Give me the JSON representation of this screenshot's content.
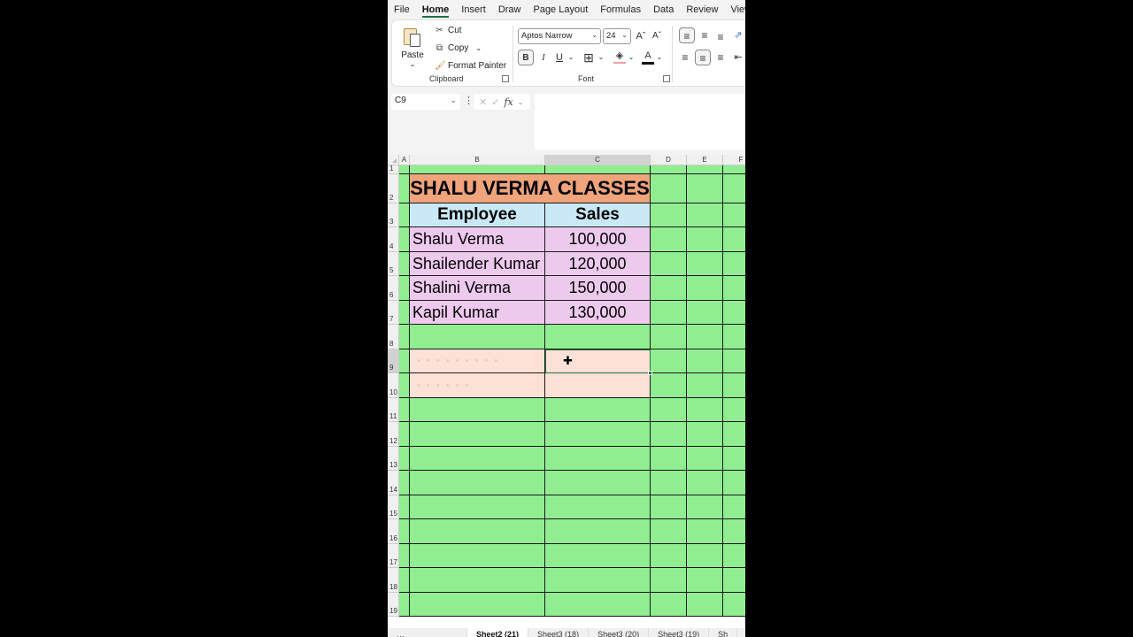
{
  "menu": {
    "tabs": [
      "File",
      "Home",
      "Insert",
      "Draw",
      "Page Layout",
      "Formulas",
      "Data",
      "Review",
      "View"
    ],
    "active": "Home"
  },
  "ribbon": {
    "clipboard": {
      "paste_label": "Paste",
      "cut_label": "Cut",
      "copy_label": "Copy",
      "format_painter_label": "Format Painter",
      "group_label": "Clipboard"
    },
    "font": {
      "font_name": "Aptos Narrow",
      "font_size": "24",
      "grow_label": "Aˆ",
      "shrink_label": "Aˇ",
      "bold_label": "B",
      "italic_label": "I",
      "underline_label": "U",
      "font_color_label": "A",
      "group_label": "Font"
    }
  },
  "formula_bar": {
    "name_box": "C9",
    "cancel_icon": "✕",
    "enter_icon": "✓",
    "fx_label": "fx",
    "formula": ""
  },
  "sheet": {
    "columns": [
      "A",
      "B",
      "C",
      "D",
      "E",
      "F"
    ],
    "selected_column": "C",
    "rows": [
      "1",
      "2",
      "3",
      "4",
      "5",
      "6",
      "7",
      "8",
      "9",
      "10",
      "11",
      "12",
      "13",
      "14",
      "15",
      "16",
      "17",
      "18",
      "19"
    ],
    "selected_row": "9",
    "title": "SHALU VERMA CLASSES",
    "headers": [
      "Employee",
      "Sales"
    ],
    "records": [
      {
        "employee": "Shalu Verma",
        "sales": "100,000"
      },
      {
        "employee": "Shailender Kumar",
        "sales": "120,000"
      },
      {
        "employee": "Shalini Verma",
        "sales": "150,000"
      },
      {
        "employee": "Kapil Kumar",
        "sales": "130,000"
      }
    ],
    "faded_row9": "• • •   • • • • • •",
    "faded_row10": "• •        • • • •",
    "colors": {
      "background_fill": "#90ee90",
      "title_fill": "#f0a47b",
      "header_fill": "#c9e9f6",
      "body_fill": "#eec9ee",
      "highlight_fill": "#fde0d6",
      "selection": "#217346"
    }
  },
  "sheet_tabs": {
    "tabs": [
      "…",
      "Sheet2 (21)",
      "Sheet3 (18)",
      "Sheet3 (20)",
      "Sheet3 (19)",
      "Sh"
    ],
    "active": "Sheet2 (21)"
  }
}
